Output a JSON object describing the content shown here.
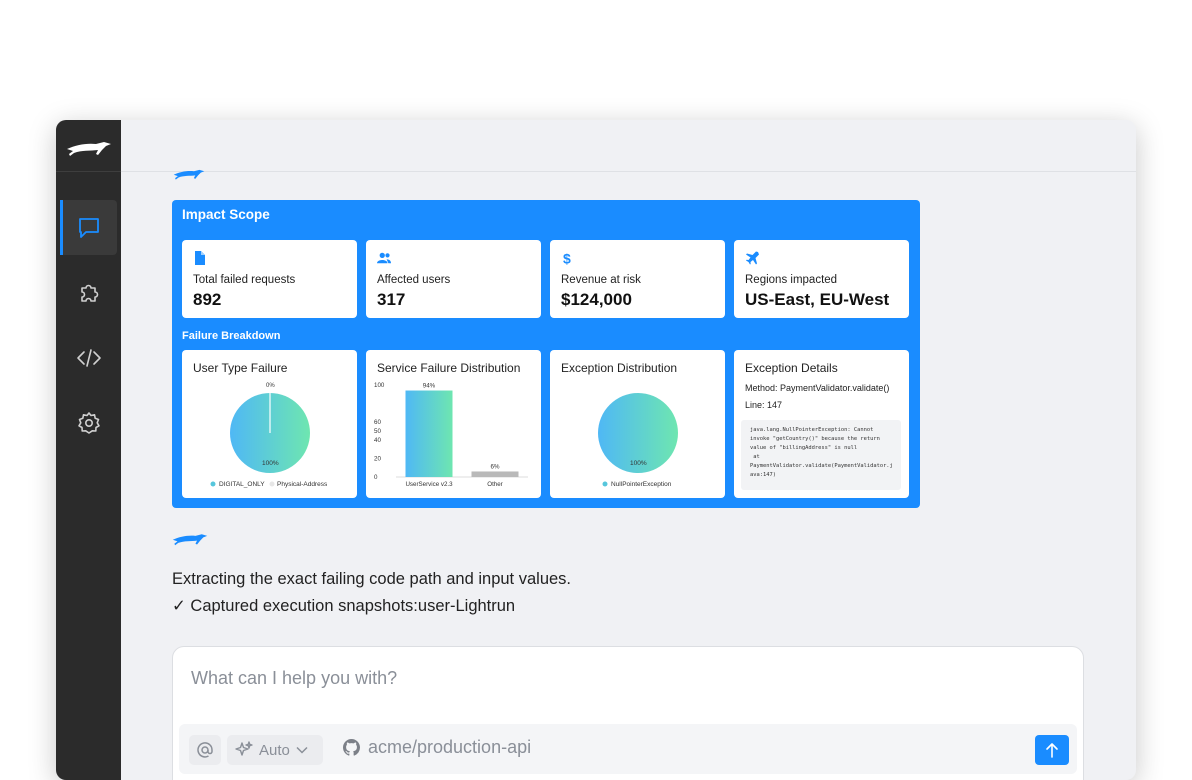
{
  "impact": {
    "title": "Impact Scope",
    "stats": [
      {
        "label": "Total failed requests",
        "value": "892",
        "icon": "file-icon"
      },
      {
        "label": "Affected users",
        "value": "317",
        "icon": "users-icon"
      },
      {
        "label": "Revenue at risk",
        "value": "$124,000",
        "icon": "dollar-icon"
      },
      {
        "label": "Regions impacted",
        "value": "US-East, EU-West",
        "icon": "plane-icon"
      }
    ],
    "breakdown_title": "Failure Breakdown",
    "user_type": {
      "title": "User Type Failure",
      "slice_top_label": "0%",
      "slice_main_label": "100%",
      "legend": [
        "DIGITAL_ONLY",
        "Physical-Address"
      ]
    },
    "service": {
      "title": "Service Failure Distribution"
    },
    "exception_dist": {
      "title": "Exception Distribution",
      "slice_label": "100%",
      "legend": [
        "NullPointerException"
      ]
    },
    "details": {
      "title": "Exception Details",
      "method": "Method: PaymentValidator.validate()",
      "line": "Line: 147",
      "stack": "java.lang.NullPointerException: Cannot\ninvoke \"getCountry()\" because the return\nvalue of \"billingAddress\" is null\n at\nPaymentValidator.validate(PaymentValidator.j\nava:147)"
    }
  },
  "chart_data": [
    {
      "type": "pie",
      "title": "User Type Failure",
      "categories": [
        "DIGITAL_ONLY",
        "Physical-Address"
      ],
      "values": [
        100,
        0
      ]
    },
    {
      "type": "bar",
      "title": "Service Failure Distribution",
      "categories": [
        "UserService v2.3",
        "Other"
      ],
      "values": [
        94,
        6
      ],
      "data_labels": [
        "94%",
        "6%"
      ],
      "ylim": [
        0,
        100
      ],
      "yticks": [
        0,
        20,
        40,
        50,
        60,
        100
      ]
    },
    {
      "type": "pie",
      "title": "Exception Distribution",
      "categories": [
        "NullPointerException"
      ],
      "values": [
        100
      ]
    }
  ],
  "messages": {
    "line1": "Extracting the exact failing code path and input values.",
    "line2": "✓ Captured execution snapshots:user-Lightrun"
  },
  "input": {
    "placeholder": "What can I help you with?",
    "mode": "Auto",
    "repo": "acme/production-api"
  },
  "colors": {
    "accent": "#1a8cff",
    "sidebar": "#2b2b2b",
    "gradient_start": "#4fb8f5",
    "gradient_end": "#6ee6b0"
  }
}
